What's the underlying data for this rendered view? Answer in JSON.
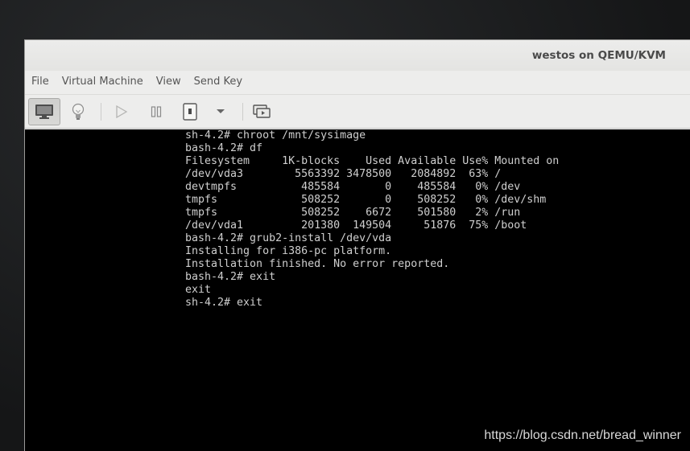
{
  "window": {
    "title": "westos on QEMU/KVM"
  },
  "menu": {
    "items": [
      {
        "label": "File"
      },
      {
        "label": "Virtual Machine"
      },
      {
        "label": "View"
      },
      {
        "label": "Send Key"
      }
    ]
  },
  "toolbar": {
    "buttons": [
      {
        "icon": "monitor-icon",
        "state": "active"
      },
      {
        "icon": "lightbulb-icon"
      },
      {
        "icon": "play-icon"
      },
      {
        "icon": "pause-icon"
      },
      {
        "icon": "power-icon"
      },
      {
        "icon": "chevron-down-icon"
      },
      {
        "icon": "screenshot-icon"
      }
    ]
  },
  "console": {
    "lines": [
      "sh-4.2# chroot /mnt/sysimage",
      "bash-4.2# df",
      "Filesystem     1K-blocks    Used Available Use% Mounted on",
      "/dev/vda3        5563392 3478500   2084892  63% /",
      "devtmpfs          485584       0    485584   0% /dev",
      "tmpfs             508252       0    508252   0% /dev/shm",
      "tmpfs             508252    6672    501580   2% /run",
      "/dev/vda1         201380  149504     51876  75% /boot",
      "bash-4.2# grub2-install /dev/vda",
      "Installing for i386-pc platform.",
      "Installation finished. No error reported.",
      "bash-4.2# exit",
      "exit",
      "sh-4.2# exit"
    ]
  },
  "watermark": "https://blog.csdn.net/bread_winner"
}
